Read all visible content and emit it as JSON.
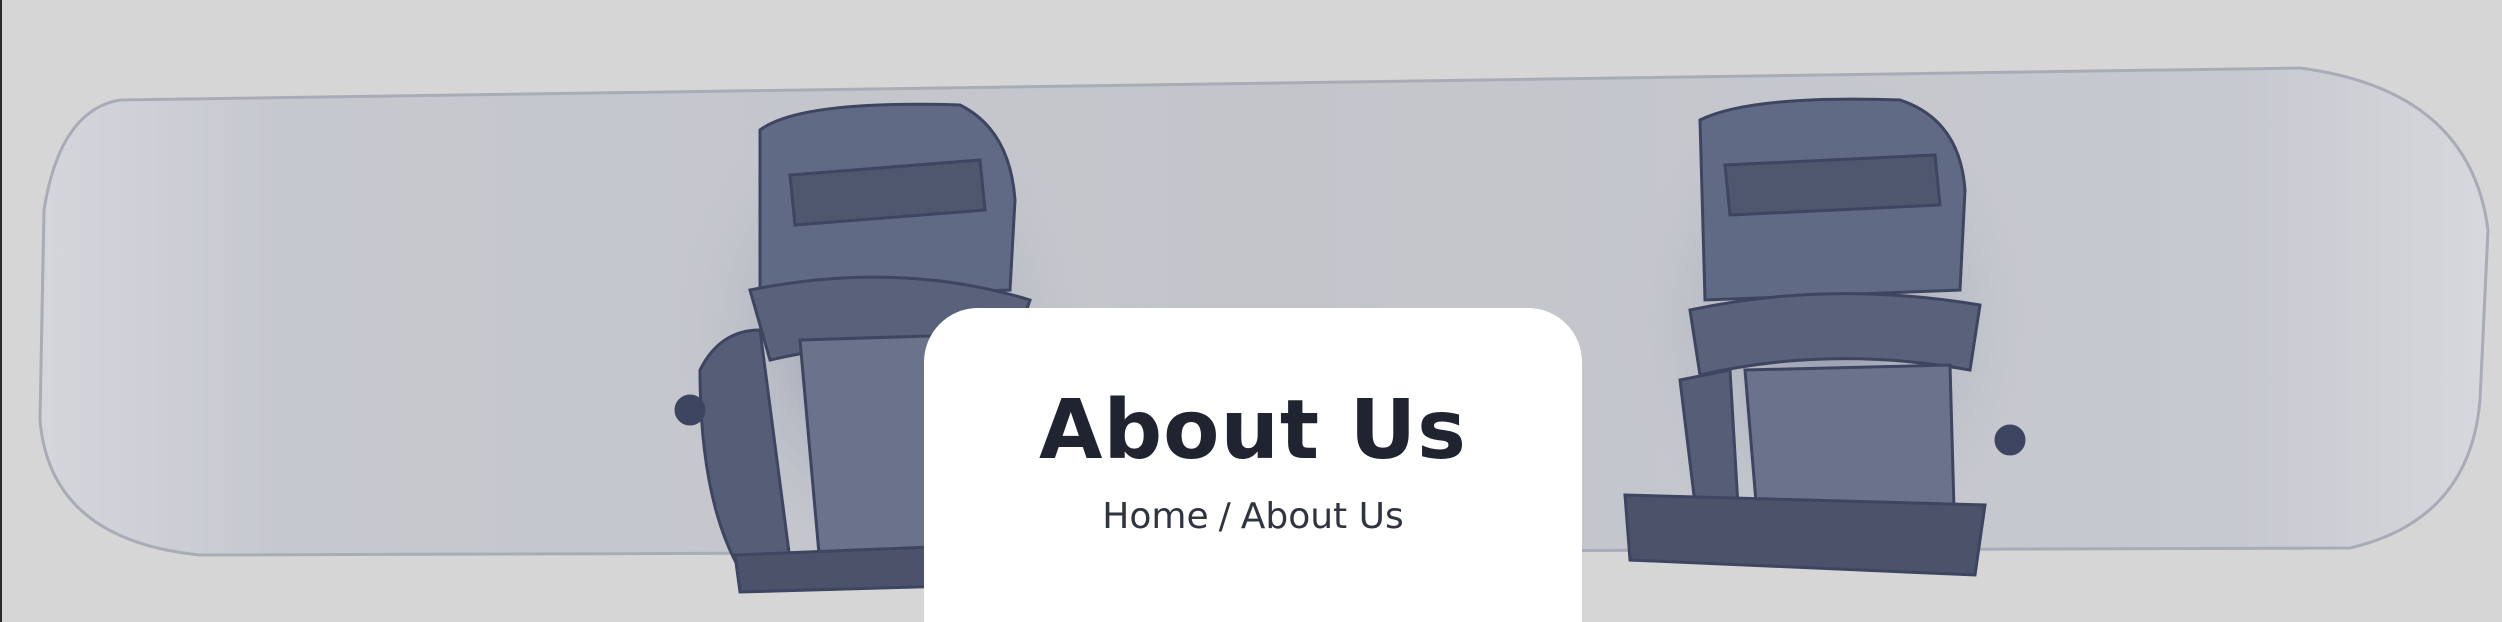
{
  "hero": {
    "title": "About Us",
    "background_image": "snowboard-with-bindings",
    "overlay_color": "#d6d6d6"
  },
  "breadcrumb": {
    "home": "Home",
    "separator": "/",
    "current": "About Us"
  },
  "colors": {
    "title": "#1f2430",
    "card": "#ffffff",
    "binding": "#5b6480"
  }
}
